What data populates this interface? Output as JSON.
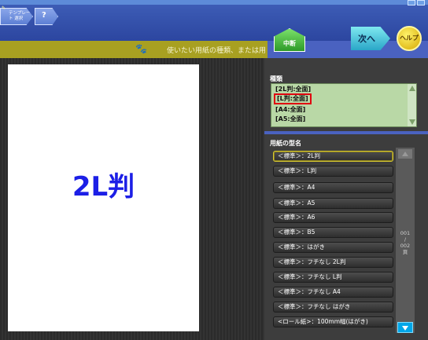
{
  "toolbar": {
    "template_label": "テンプレート 選択",
    "help_q_label": "?",
    "cancel_label": "中断",
    "next_label": "次へ",
    "help_label": "ヘルプ"
  },
  "instruction": "使いたい用紙の種類、または用",
  "type_section": {
    "title": "種類",
    "items": [
      "[2L判:全面]",
      "[L判:全面]",
      "[A4:全面]",
      "[A5:全面]"
    ],
    "selected_index": 1
  },
  "model_section": {
    "title": "用紙の型名",
    "items": [
      "＜標準＞：2L判",
      "＜標準＞：L判",
      "＜標準＞：A4",
      "＜標準＞：A5",
      "＜標準＞：A6",
      "＜標準＞：B5",
      "＜標準＞：はがき",
      "＜標準＞：フチなし 2L判",
      "＜標準＞：フチなし L判",
      "＜標準＞：フチなし A4",
      "＜標準＞：フチなし はがき",
      "<ロール紙>：100mm幅(はがき)"
    ],
    "active_index": 0,
    "page_current": "001",
    "page_sep": "/",
    "page_total": "002",
    "page_unit": "頁"
  },
  "preview": {
    "label": "2L判"
  },
  "colors": {
    "accent": "#4a62c0",
    "strip": "#a8a021",
    "list_bg": "#b9d8a6",
    "selection": "#e00010"
  }
}
